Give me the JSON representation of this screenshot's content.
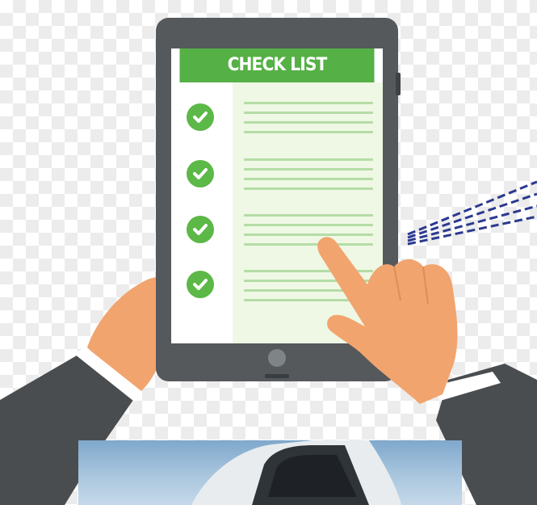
{
  "checklist": {
    "title": "CHECK LIST",
    "item_count": 4
  },
  "colors": {
    "header_green": "#55b046",
    "check_green": "#5cb847",
    "list_background": "#eef8e4",
    "list_lines": "#b5dca6",
    "tablet_frame": "#55595c",
    "skin": "#f2a46e",
    "sleeve": "#4a4d50",
    "pointer_dashes": "#2b3a8f"
  },
  "icons": {
    "check": "checkmark-circle-icon",
    "home": "home-button-icon"
  }
}
